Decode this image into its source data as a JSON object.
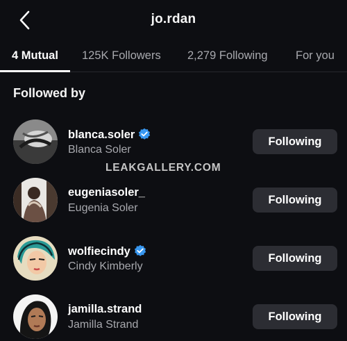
{
  "header": {
    "title": "jo.rdan",
    "back_icon": "chevron-left-icon"
  },
  "tabs": [
    {
      "label": "4 Mutual",
      "active": true
    },
    {
      "label": "125K Followers",
      "active": false
    },
    {
      "label": "2,279 Following",
      "active": false
    },
    {
      "label": "For you",
      "active": false
    }
  ],
  "section_title": "Followed by",
  "users": [
    {
      "username": "blanca.soler",
      "full_name": "Blanca Soler",
      "verified": true,
      "button_label": "Following"
    },
    {
      "username": "eugeniasoler_",
      "full_name": "Eugenia Soler",
      "verified": false,
      "button_label": "Following"
    },
    {
      "username": "wolfiecindy",
      "full_name": "Cindy Kimberly",
      "verified": true,
      "button_label": "Following"
    },
    {
      "username": "jamilla.strand",
      "full_name": "Jamilla Strand",
      "verified": false,
      "button_label": "Following"
    }
  ],
  "watermark": "LEAKGALLERY.COM",
  "colors": {
    "background": "#0d0e12",
    "button": "#2c2d33",
    "secondary_text": "#a8a9ae",
    "verified": "#3897f0"
  }
}
